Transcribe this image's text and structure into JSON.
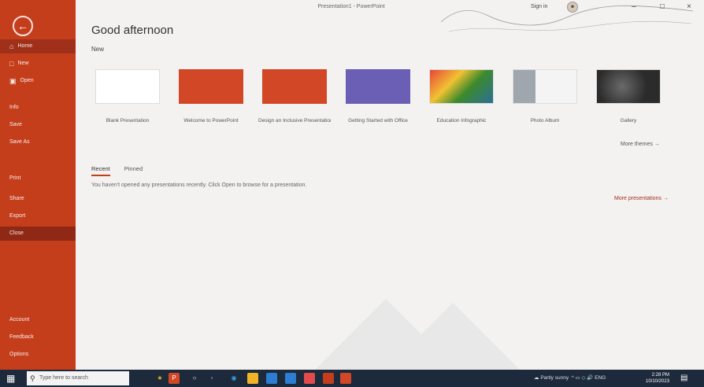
{
  "app": {
    "greeting": "Good afternoon",
    "document_title": "Presentation1 - PowerPoint",
    "user_name": "Sign in"
  },
  "sidebar": {
    "back_icon": "arrow-left-icon",
    "items": [
      {
        "label": "Home",
        "icon": "home-icon"
      },
      {
        "label": "New",
        "icon": "new-doc-icon"
      },
      {
        "label": "Open",
        "icon": "folder-icon"
      },
      {
        "label": "Info"
      },
      {
        "label": "Save"
      },
      {
        "label": "Save As"
      },
      {
        "label": "Print"
      },
      {
        "label": "Share"
      },
      {
        "label": "Export"
      },
      {
        "label": "Close"
      },
      {
        "label": "Account"
      },
      {
        "label": "Feedback"
      },
      {
        "label": "Options"
      }
    ]
  },
  "main": {
    "new_label": "New",
    "templates": [
      {
        "name": "Blank Presentation",
        "color": "#ffffff"
      },
      {
        "name": "Welcome to PowerPoint",
        "color": "#d24726"
      },
      {
        "name": "Design an Inclusive Presentation",
        "color": "#d24726"
      },
      {
        "name": "Getting Started with Office",
        "color": "#6b5fb5"
      },
      {
        "name": "Education Infographic",
        "color": "#3d8a2c"
      },
      {
        "name": "Photo Album",
        "color": "#c4c8cc"
      },
      {
        "name": "Gallery",
        "color": "#2b2b2b"
      }
    ],
    "more_themes": "More themes →",
    "tabs": [
      "Recent",
      "Pinned"
    ],
    "empty_message": "You haven't opened any presentations recently. Click Open to browse for a presentation.",
    "more_presentations": "More presentations →"
  },
  "taskbar": {
    "search_placeholder": "Type here to search",
    "tray_text": "Partly sunny",
    "time": "2:28 PM",
    "date": "10/10/2023"
  },
  "colors": {
    "accent": "#c43e1c",
    "accent_dark": "#a0301a",
    "taskbar": "#1d2a3c"
  }
}
